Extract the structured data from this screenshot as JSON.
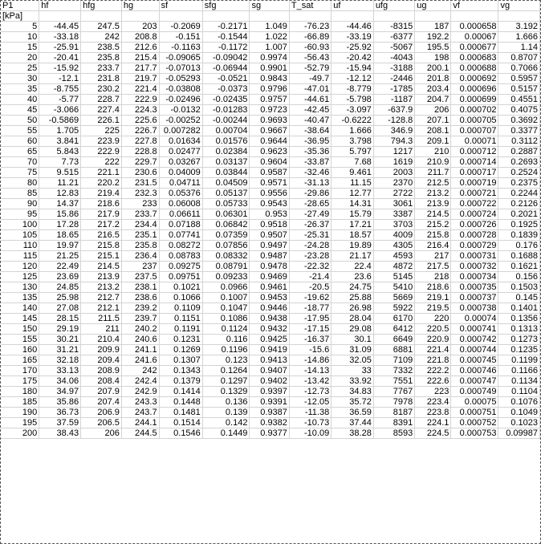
{
  "colors": {
    "gridline": "#d4d4d4",
    "border": "#555555",
    "text": "#000000"
  },
  "header_row_1": [
    "P1",
    "hf",
    "hfg",
    "hg",
    "sf",
    "sfg",
    "sg",
    "T_sat",
    "uf",
    "ufg",
    "ug",
    "vf",
    "vg"
  ],
  "header_row_2": [
    "[kPa]",
    "",
    "",
    "",
    "",
    "",
    "",
    "",
    "",
    "",
    "",
    "",
    ""
  ],
  "rows": [
    [
      "5",
      "-44.45",
      "247.5",
      "203",
      "-0.2069",
      "-0.2171",
      "1.049",
      "-76.23",
      "-44.46",
      "-8315",
      "187",
      "0.000658",
      "3.192"
    ],
    [
      "10",
      "-33.18",
      "242",
      "208.8",
      "-0.151",
      "-0.1544",
      "1.022",
      "-66.89",
      "-33.19",
      "-6377",
      "192.2",
      "0.00067",
      "1.666"
    ],
    [
      "15",
      "-25.91",
      "238.5",
      "212.6",
      "-0.1163",
      "-0.1172",
      "1.007",
      "-60.93",
      "-25.92",
      "-5067",
      "195.5",
      "0.000677",
      "1.14"
    ],
    [
      "20",
      "-20.41",
      "235.8",
      "215.4",
      "-0.09065",
      "-0.09042",
      "0.9974",
      "-56.43",
      "-20.42",
      "-4043",
      "198",
      "0.000683",
      "0.8707"
    ],
    [
      "25",
      "-15.92",
      "233.7",
      "217.7",
      "-0.07013",
      "-0.06944",
      "0.9901",
      "-52.79",
      "-15.94",
      "-3188",
      "200.1",
      "0.000688",
      "0.7066"
    ],
    [
      "30",
      "-12.1",
      "231.8",
      "219.7",
      "-0.05293",
      "-0.0521",
      "0.9843",
      "-49.7",
      "-12.12",
      "-2446",
      "201.8",
      "0.000692",
      "0.5957"
    ],
    [
      "35",
      "-8.755",
      "230.2",
      "221.4",
      "-0.03808",
      "-0.0373",
      "0.9796",
      "-47.01",
      "-8.779",
      "-1785",
      "203.4",
      "0.000696",
      "0.5157"
    ],
    [
      "40",
      "-5.77",
      "228.7",
      "222.9",
      "-0.02496",
      "-0.02435",
      "0.9757",
      "-44.61",
      "-5.798",
      "-1187",
      "204.7",
      "0.000699",
      "0.4551"
    ],
    [
      "45",
      "-3.066",
      "227.4",
      "224.3",
      "-0.0132",
      "-0.01283",
      "0.9723",
      "-42.45",
      "-3.097",
      "-637.9",
      "206",
      "0.000702",
      "0.4075"
    ],
    [
      "50",
      "-0.5869",
      "226.1",
      "225.6",
      "-0.00252",
      "-0.00244",
      "0.9693",
      "-40.47",
      "-0.6222",
      "-128.8",
      "207.1",
      "0.000705",
      "0.3692"
    ],
    [
      "55",
      "1.705",
      "225",
      "226.7",
      "0.007282",
      "0.00704",
      "0.9667",
      "-38.64",
      "1.666",
      "346.9",
      "208.1",
      "0.000707",
      "0.3377"
    ],
    [
      "60",
      "3.841",
      "223.9",
      "227.8",
      "0.01634",
      "0.01576",
      "0.9644",
      "-36.95",
      "3.798",
      "794.3",
      "209.1",
      "0.00071",
      "0.3112"
    ],
    [
      "65",
      "5.843",
      "222.9",
      "228.8",
      "0.02477",
      "0.02384",
      "0.9623",
      "-35.36",
      "5.797",
      "1217",
      "210",
      "0.000712",
      "0.2887"
    ],
    [
      "70",
      "7.73",
      "222",
      "229.7",
      "0.03267",
      "0.03137",
      "0.9604",
      "-33.87",
      "7.68",
      "1619",
      "210.9",
      "0.000714",
      "0.2693"
    ],
    [
      "75",
      "9.515",
      "221.1",
      "230.6",
      "0.04009",
      "0.03844",
      "0.9587",
      "-32.46",
      "9.461",
      "2003",
      "211.7",
      "0.000717",
      "0.2524"
    ],
    [
      "80",
      "11.21",
      "220.2",
      "231.5",
      "0.04711",
      "0.04509",
      "0.9571",
      "-31.13",
      "11.15",
      "2370",
      "212.5",
      "0.000719",
      "0.2375"
    ],
    [
      "85",
      "12.83",
      "219.4",
      "232.3",
      "0.05376",
      "0.05137",
      "0.9556",
      "-29.86",
      "12.77",
      "2722",
      "213.2",
      "0.000721",
      "0.2244"
    ],
    [
      "90",
      "14.37",
      "218.6",
      "233",
      "0.06008",
      "0.05733",
      "0.9543",
      "-28.65",
      "14.31",
      "3061",
      "213.9",
      "0.000722",
      "0.2126"
    ],
    [
      "95",
      "15.86",
      "217.9",
      "233.7",
      "0.06611",
      "0.06301",
      "0.953",
      "-27.49",
      "15.79",
      "3387",
      "214.5",
      "0.000724",
      "0.2021"
    ],
    [
      "100",
      "17.28",
      "217.2",
      "234.4",
      "0.07188",
      "0.06842",
      "0.9518",
      "-26.37",
      "17.21",
      "3703",
      "215.2",
      "0.000726",
      "0.1925"
    ],
    [
      "105",
      "18.65",
      "216.5",
      "235.1",
      "0.07741",
      "0.07359",
      "0.9507",
      "-25.31",
      "18.57",
      "4009",
      "215.8",
      "0.000728",
      "0.1839"
    ],
    [
      "110",
      "19.97",
      "215.8",
      "235.8",
      "0.08272",
      "0.07856",
      "0.9497",
      "-24.28",
      "19.89",
      "4305",
      "216.4",
      "0.000729",
      "0.176"
    ],
    [
      "115",
      "21.25",
      "215.1",
      "236.4",
      "0.08783",
      "0.08332",
      "0.9487",
      "-23.28",
      "21.17",
      "4593",
      "217",
      "0.000731",
      "0.1688"
    ],
    [
      "120",
      "22.49",
      "214.5",
      "237",
      "0.09275",
      "0.08791",
      "0.9478",
      "-22.32",
      "22.4",
      "4872",
      "217.5",
      "0.000732",
      "0.1621"
    ],
    [
      "125",
      "23.69",
      "213.9",
      "237.5",
      "0.09751",
      "0.09233",
      "0.9469",
      "-21.4",
      "23.6",
      "5145",
      "218",
      "0.000734",
      "0.156"
    ],
    [
      "130",
      "24.85",
      "213.2",
      "238.1",
      "0.1021",
      "0.0966",
      "0.9461",
      "-20.5",
      "24.75",
      "5410",
      "218.6",
      "0.000735",
      "0.1503"
    ],
    [
      "135",
      "25.98",
      "212.7",
      "238.6",
      "0.1066",
      "0.1007",
      "0.9453",
      "-19.62",
      "25.88",
      "5669",
      "219.1",
      "0.000737",
      "0.145"
    ],
    [
      "140",
      "27.08",
      "212.1",
      "239.2",
      "0.1109",
      "0.1047",
      "0.9446",
      "-18.77",
      "26.98",
      "5922",
      "219.5",
      "0.000738",
      "0.1401"
    ],
    [
      "145",
      "28.15",
      "211.5",
      "239.7",
      "0.1151",
      "0.1086",
      "0.9438",
      "-17.95",
      "28.04",
      "6170",
      "220",
      "0.00074",
      "0.1356"
    ],
    [
      "150",
      "29.19",
      "211",
      "240.2",
      "0.1191",
      "0.1124",
      "0.9432",
      "-17.15",
      "29.08",
      "6412",
      "220.5",
      "0.000741",
      "0.1313"
    ],
    [
      "155",
      "30.21",
      "210.4",
      "240.6",
      "0.1231",
      "0.116",
      "0.9425",
      "-16.37",
      "30.1",
      "6649",
      "220.9",
      "0.000742",
      "0.1273"
    ],
    [
      "160",
      "31.21",
      "209.9",
      "241.1",
      "0.1269",
      "0.1196",
      "0.9419",
      "-15.6",
      "31.09",
      "6881",
      "221.4",
      "0.000744",
      "0.1235"
    ],
    [
      "165",
      "32.18",
      "209.4",
      "241.6",
      "0.1307",
      "0.123",
      "0.9413",
      "-14.86",
      "32.05",
      "7109",
      "221.8",
      "0.000745",
      "0.1199"
    ],
    [
      "170",
      "33.13",
      "208.9",
      "242",
      "0.1343",
      "0.1264",
      "0.9407",
      "-14.13",
      "33",
      "7332",
      "222.2",
      "0.000746",
      "0.1166"
    ],
    [
      "175",
      "34.06",
      "208.4",
      "242.4",
      "0.1379",
      "0.1297",
      "0.9402",
      "-13.42",
      "33.92",
      "7551",
      "222.6",
      "0.000747",
      "0.1134"
    ],
    [
      "180",
      "34.97",
      "207.9",
      "242.9",
      "0.1414",
      "0.1329",
      "0.9397",
      "-12.73",
      "34.83",
      "7767",
      "223",
      "0.000749",
      "0.1104"
    ],
    [
      "185",
      "35.86",
      "207.4",
      "243.3",
      "0.1448",
      "0.136",
      "0.9391",
      "-12.05",
      "35.72",
      "7978",
      "223.4",
      "0.00075",
      "0.1076"
    ],
    [
      "190",
      "36.73",
      "206.9",
      "243.7",
      "0.1481",
      "0.139",
      "0.9387",
      "-11.38",
      "36.59",
      "8187",
      "223.8",
      "0.000751",
      "0.1049"
    ],
    [
      "195",
      "37.59",
      "206.5",
      "244.1",
      "0.1514",
      "0.142",
      "0.9382",
      "-10.73",
      "37.44",
      "8391",
      "224.1",
      "0.000752",
      "0.1023"
    ],
    [
      "200",
      "38.43",
      "206",
      "244.5",
      "0.1546",
      "0.1449",
      "0.9377",
      "-10.09",
      "38.28",
      "8593",
      "224.5",
      "0.000753",
      "0.09987"
    ]
  ]
}
